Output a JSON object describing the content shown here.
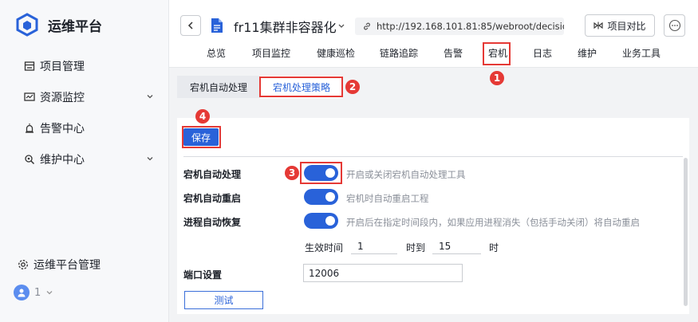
{
  "sidebar": {
    "brand": "运维平台",
    "items": [
      {
        "label": "项目管理",
        "icon": "project-icon",
        "expandable": false
      },
      {
        "label": "资源监控",
        "icon": "monitor-icon",
        "expandable": true
      },
      {
        "label": "告警中心",
        "icon": "alarm-icon",
        "expandable": false
      },
      {
        "label": "维护中心",
        "icon": "maintenance-icon",
        "expandable": true
      }
    ],
    "bottom_item": "运维平台管理",
    "user_number": "1"
  },
  "header": {
    "project_name": "fr11集群非容器化",
    "url": "http://192.168.101.81:85/webroot/decision",
    "compare_label": "项目对比",
    "tabs": [
      "总览",
      "项目监控",
      "健康巡检",
      "链路追踪",
      "告警",
      "宕机",
      "日志",
      "维护",
      "业务工具"
    ],
    "active_tab": "宕机"
  },
  "subtabs": {
    "items": [
      "宕机自动处理",
      "宕机处理策略"
    ],
    "active": "宕机处理策略"
  },
  "panel": {
    "save_label": "保存",
    "rows": [
      {
        "label": "宕机自动处理",
        "enabled": true,
        "desc": "开启或关闭宕机自动处理工具"
      },
      {
        "label": "宕机自动重启",
        "enabled": true,
        "desc": "宕机时自动重启工程"
      },
      {
        "label": "进程自动恢复",
        "enabled": true,
        "desc": "开启后在指定时间段内，如果应用进程消失（包括手动关闭）将自动重启"
      }
    ],
    "time": {
      "start_label": "生效时间",
      "start_value": "1",
      "to_label": "时到",
      "end_value": "15",
      "end_unit": "时"
    },
    "port": {
      "label": "端口设置",
      "value": "12006"
    },
    "test_label": "测试"
  },
  "annotations": {
    "badge_1": "1",
    "badge_2": "2",
    "badge_3": "3",
    "badge_4": "4",
    "color": "#e53935"
  },
  "colors": {
    "accent": "#2962d9",
    "sidebar_bg": "#f7f8fa",
    "content_bg": "#f2f3f5"
  }
}
